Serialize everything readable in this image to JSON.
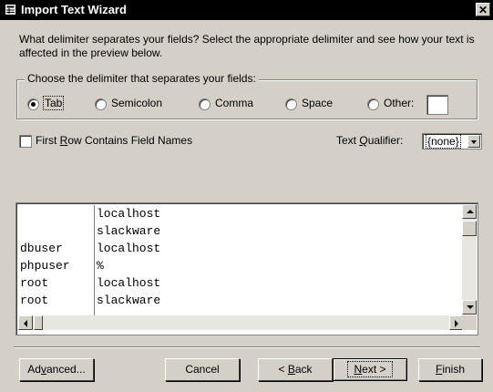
{
  "window": {
    "title": "Import Text Wizard",
    "close_glyph": "✕"
  },
  "description": "What delimiter separates your fields? Select the appropriate delimiter and see how your text is affected in the preview below.",
  "delimiter_group": {
    "label": "Choose the delimiter that separates your fields:",
    "options": [
      "Tab",
      "Semicolon",
      "Comma",
      "Space",
      "Other:"
    ],
    "selected": "Tab",
    "other_value": ""
  },
  "first_row_checkbox": {
    "label_pre": "First ",
    "label_accel": "R",
    "label_post": "ow Contains Field Names",
    "checked": false
  },
  "text_qualifier": {
    "label_pre": "Text ",
    "label_accel": "Q",
    "label_post": "ualifier:",
    "value": "{none}"
  },
  "preview": {
    "rows": [
      [
        "",
        "localhost"
      ],
      [
        "",
        "slackware"
      ],
      [
        "dbuser",
        "localhost"
      ],
      [
        "phpuser",
        "%"
      ],
      [
        "root",
        "localhost"
      ],
      [
        "root",
        "slackware"
      ]
    ]
  },
  "buttons": {
    "advanced": {
      "pre": "Ad",
      "accel": "v",
      "post": "anced..."
    },
    "cancel": "Cancel",
    "back": {
      "pre": "< ",
      "accel": "B",
      "post": "ack"
    },
    "next": {
      "accel": "N",
      "post": "ext >"
    },
    "finish": {
      "accel": "F",
      "post": "inish"
    }
  },
  "icons": {
    "app": "table-icon",
    "close": "close-icon"
  }
}
